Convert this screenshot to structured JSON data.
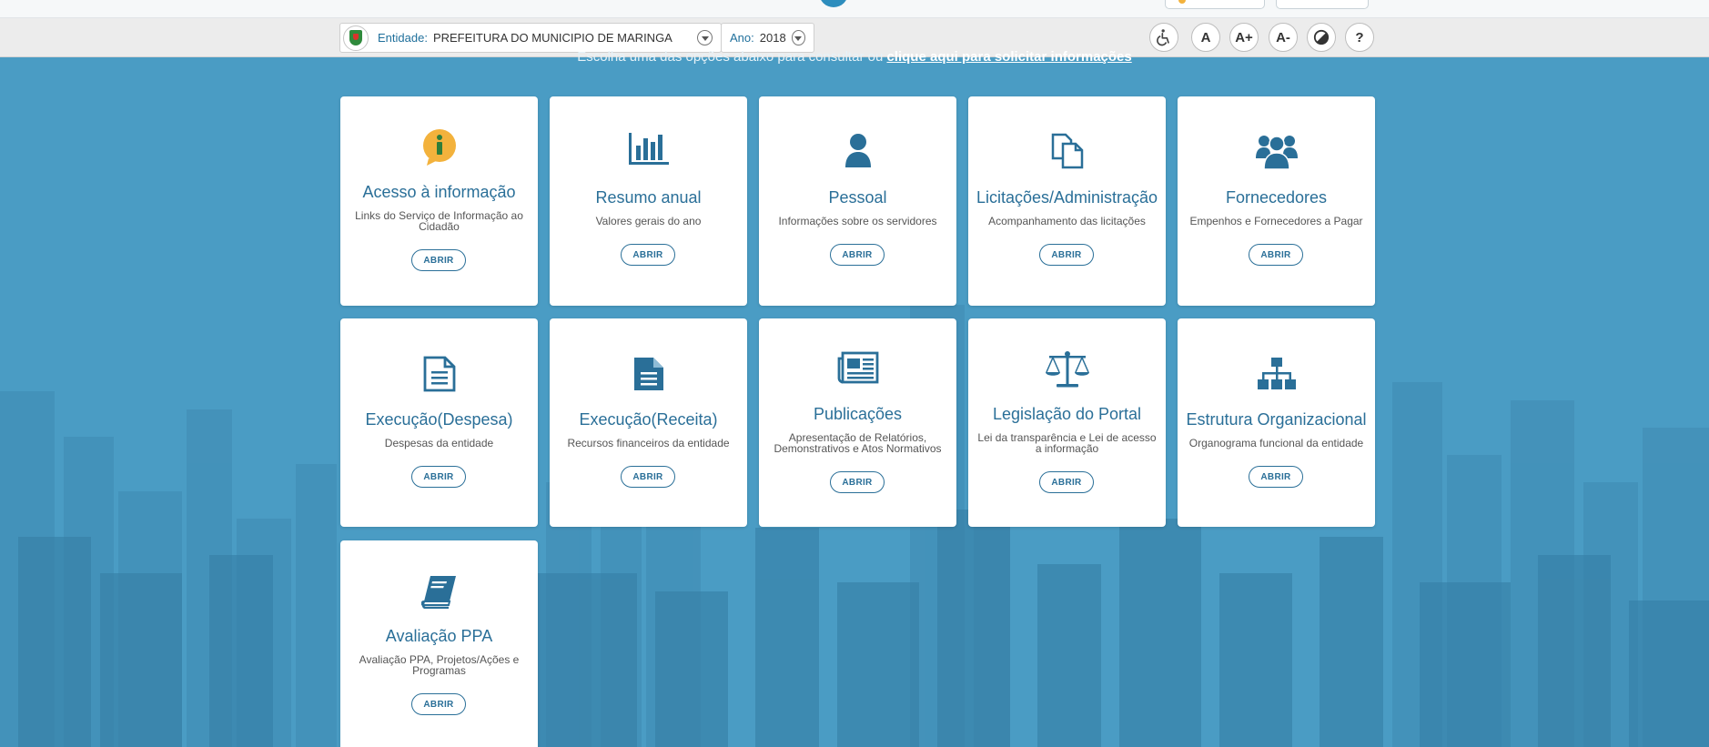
{
  "toolbar": {
    "entity_label": "Entidade:",
    "entity_value": "PREFEITURA DO MUNICIPIO DE MARINGA",
    "year_label": "Ano:",
    "year_value": "2018",
    "font_normal_label": "A",
    "font_increase_label": "A+",
    "font_decrease_label": "A-",
    "help_label": "?"
  },
  "intro": {
    "text": "Escolha uma das opções abaixo para consultar ou ",
    "link": "clique aqui para solicitar informações"
  },
  "cards": [
    {
      "title": "Acesso à informação",
      "desc": "Links do Serviço de Informação ao Cidadão",
      "button": "ABRIR",
      "icon": "info-icon"
    },
    {
      "title": "Resumo anual",
      "desc": "Valores gerais do ano",
      "button": "ABRIR",
      "icon": "bar-chart-icon"
    },
    {
      "title": "Pessoal",
      "desc": "Informações sobre os servidores",
      "button": "ABRIR",
      "icon": "person-icon"
    },
    {
      "title": "Licitações/Administração",
      "desc": "Acompanhamento das licitações",
      "button": "ABRIR",
      "icon": "documents-icon"
    },
    {
      "title": "Fornecedores",
      "desc": "Empenhos e Fornecedores a Pagar",
      "button": "ABRIR",
      "icon": "group-icon"
    },
    {
      "title": "Execução(Despesa)",
      "desc": "Despesas da entidade",
      "button": "ABRIR",
      "icon": "document-outline-icon"
    },
    {
      "title": "Execução(Receita)",
      "desc": "Recursos financeiros da entidade",
      "button": "ABRIR",
      "icon": "document-filled-icon"
    },
    {
      "title": "Publicações",
      "desc": "Apresentação de Relatórios, Demonstrativos e Atos Normativos",
      "button": "ABRIR",
      "icon": "newspaper-icon"
    },
    {
      "title": "Legislação do Portal",
      "desc": "Lei da transparência e Lei de acesso a informação",
      "button": "ABRIR",
      "icon": "scales-icon"
    },
    {
      "title": "Estrutura Organizacional",
      "desc": "Organograma funcional da entidade",
      "button": "ABRIR",
      "icon": "org-chart-icon"
    },
    {
      "title": "Avaliação PPA",
      "desc": "Avaliação PPA, Projetos/Ações e Programas",
      "button": "ABRIR",
      "icon": "book-icon"
    }
  ],
  "colors": {
    "background": "#4a9cc4",
    "accent": "#2a6f98",
    "icon": "#2a6f98",
    "info_yellow": "#f3b23c"
  }
}
